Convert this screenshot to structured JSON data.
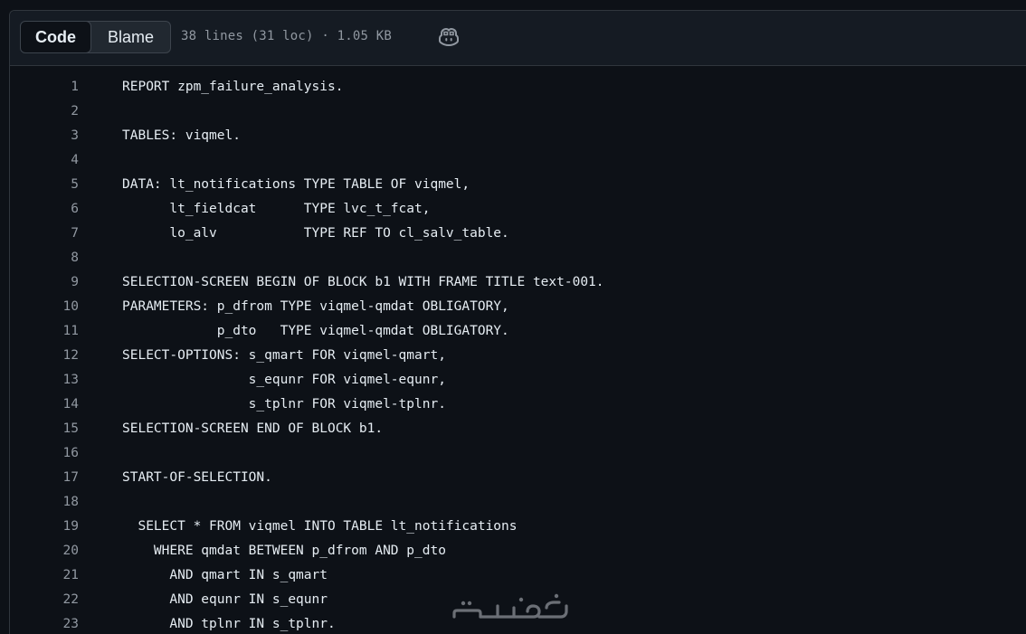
{
  "toolbar": {
    "code_label": "Code",
    "blame_label": "Blame",
    "file_meta": "38 lines (31 loc) · 1.05 KB",
    "copilot_icon": "copilot-icon"
  },
  "code_lines": [
    {
      "n": "1",
      "text": "REPORT zpm_failure_analysis."
    },
    {
      "n": "2",
      "text": ""
    },
    {
      "n": "3",
      "text": "TABLES: viqmel."
    },
    {
      "n": "4",
      "text": ""
    },
    {
      "n": "5",
      "text": "DATA: lt_notifications TYPE TABLE OF viqmel,"
    },
    {
      "n": "6",
      "text": "      lt_fieldcat      TYPE lvc_t_fcat,"
    },
    {
      "n": "7",
      "text": "      lo_alv           TYPE REF TO cl_salv_table."
    },
    {
      "n": "8",
      "text": ""
    },
    {
      "n": "9",
      "text": "SELECTION-SCREEN BEGIN OF BLOCK b1 WITH FRAME TITLE text-001."
    },
    {
      "n": "10",
      "text": "PARAMETERS: p_dfrom TYPE viqmel-qmdat OBLIGATORY,"
    },
    {
      "n": "11",
      "text": "            p_dto   TYPE viqmel-qmdat OBLIGATORY."
    },
    {
      "n": "12",
      "text": "SELECT-OPTIONS: s_qmart FOR viqmel-qmart,"
    },
    {
      "n": "13",
      "text": "                s_equnr FOR viqmel-equnr,"
    },
    {
      "n": "14",
      "text": "                s_tplnr FOR viqmel-tplnr."
    },
    {
      "n": "15",
      "text": "SELECTION-SCREEN END OF BLOCK b1."
    },
    {
      "n": "16",
      "text": ""
    },
    {
      "n": "17",
      "text": "START-OF-SELECTION."
    },
    {
      "n": "18",
      "text": ""
    },
    {
      "n": "19",
      "text": "  SELECT * FROM viqmel INTO TABLE lt_notifications"
    },
    {
      "n": "20",
      "text": "    WHERE qmdat BETWEEN p_dfrom AND p_dto"
    },
    {
      "n": "21",
      "text": "      AND qmart IN s_qmart"
    },
    {
      "n": "22",
      "text": "      AND equnr IN s_equnr"
    },
    {
      "n": "23",
      "text": "      AND tplnr IN s_tplnr."
    }
  ],
  "colors": {
    "background": "#0d1117",
    "toolbar": "#151b23",
    "text": "#e6edf3",
    "muted": "#9198a1",
    "border": "#30363d"
  }
}
